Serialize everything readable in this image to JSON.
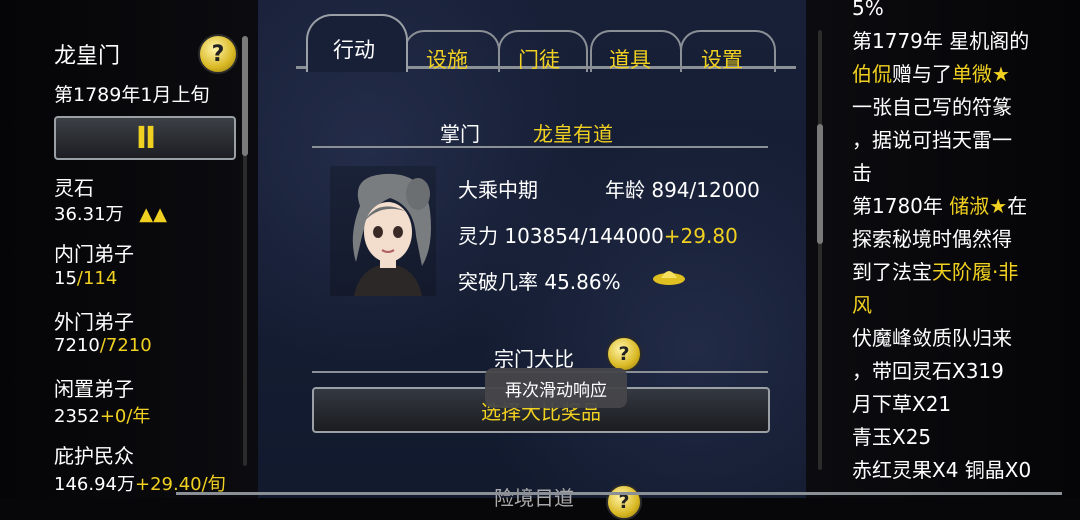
{
  "left": {
    "sect_name": "龙皇门",
    "date": "第1789年1月上旬",
    "help_glyph": "?",
    "pause_glyph": "II",
    "stats": {
      "spirit_stone_label": "灵石",
      "spirit_stone_value": "36.31万",
      "spirit_stone_trend": "▲▲",
      "inner_label": "内门弟子",
      "inner_value": "15",
      "inner_max": "/114",
      "outer_label": "外门弟子",
      "outer_value": "7210",
      "outer_max": "/7210",
      "idle_label": "闲置弟子",
      "idle_value": "2352",
      "idle_rate": "+0/年",
      "people_label": "庇护民众",
      "people_value": "146.94万",
      "people_rate": "+29.40/旬"
    }
  },
  "tabs": {
    "action": "行动",
    "facilities": "设施",
    "disciples": "门徒",
    "items": "道具",
    "settings": "设置"
  },
  "leader": {
    "label": "掌门",
    "name": "龙皇有道",
    "realm": "大乘中期",
    "age_label": "年龄",
    "age_value": "894/12000",
    "power_label": "灵力",
    "power_value": "103854/144000",
    "power_rate": "+29.80",
    "breakthrough_label": "突破几率",
    "breakthrough_value": "45.86%"
  },
  "competition": {
    "title": "宗门大比",
    "help_glyph": "?",
    "button_label": "选择大比奖品",
    "toast": "再次滑动响应",
    "next_section_partial": "险境日道"
  },
  "log": {
    "lines": [
      {
        "parts": [
          {
            "t": "5%",
            "c": "#ffffff"
          }
        ]
      },
      {
        "parts": [
          {
            "t": "第1779年 星机阁的",
            "c": "#ffffff"
          }
        ]
      },
      {
        "parts": [
          {
            "t": "伯侃",
            "c": "#f0d020"
          },
          {
            "t": "赠与了",
            "c": "#ffffff"
          },
          {
            "t": "单微★",
            "c": "#f0d020"
          }
        ]
      },
      {
        "parts": [
          {
            "t": "一张自己写的符篆",
            "c": "#ffffff"
          }
        ]
      },
      {
        "parts": [
          {
            "t": "，据说可挡天雷一",
            "c": "#ffffff"
          }
        ]
      },
      {
        "parts": [
          {
            "t": "击",
            "c": "#ffffff"
          }
        ]
      },
      {
        "parts": [
          {
            "t": "第1780年 ",
            "c": "#ffffff"
          },
          {
            "t": "储淑★",
            "c": "#f0d020"
          },
          {
            "t": "在",
            "c": "#ffffff"
          }
        ]
      },
      {
        "parts": [
          {
            "t": "探索秘境时偶然得",
            "c": "#ffffff"
          }
        ]
      },
      {
        "parts": [
          {
            "t": "到了法宝",
            "c": "#ffffff"
          },
          {
            "t": "天阶履·非",
            "c": "#f0d020"
          }
        ]
      },
      {
        "parts": [
          {
            "t": "风",
            "c": "#f0d020"
          }
        ]
      },
      {
        "parts": [
          {
            "t": "伏魔峰敛质队归来",
            "c": "#ffffff"
          }
        ]
      },
      {
        "parts": [
          {
            "t": "，带回灵石X319",
            "c": "#ffffff"
          }
        ]
      },
      {
        "parts": [
          {
            "t": "月下草X21",
            "c": "#ffffff"
          }
        ]
      },
      {
        "parts": [
          {
            "t": "青玉X25",
            "c": "#ffffff"
          }
        ]
      },
      {
        "parts": [
          {
            "t": "赤红灵果X4 铜晶X0",
            "c": "#ffffff"
          }
        ]
      }
    ]
  }
}
